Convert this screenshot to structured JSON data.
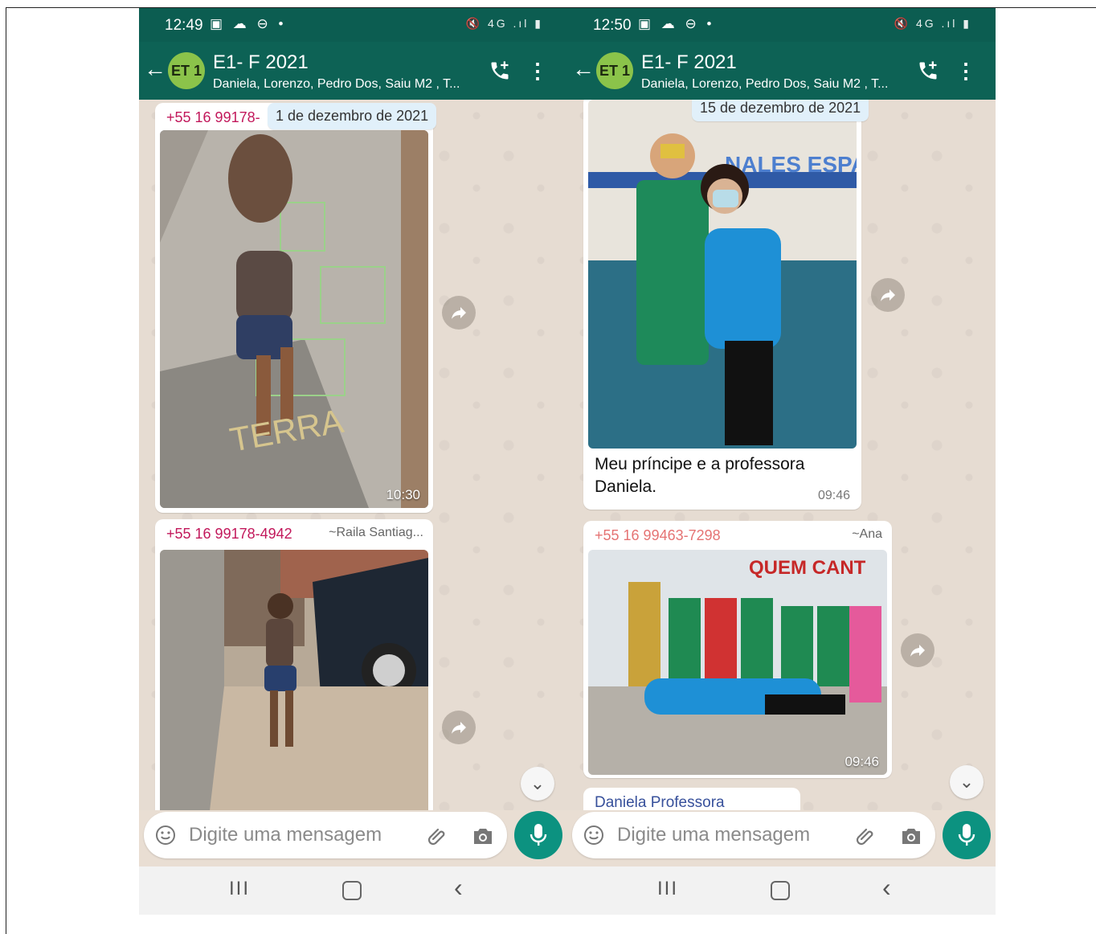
{
  "left": {
    "status_time": "12:49",
    "status_icons_left": "▣ ☁ ⊖ •",
    "status_icons_right": "🔇 4G .ıl ▮",
    "chat_title": "E1- F 2021",
    "chat_subtitle": "Daniela, Lorenzo, Pedro Dos, Saiu M2 , T...",
    "avatar_text": "ET 1",
    "date_chip": "1 de dezembro de 2021",
    "msg1": {
      "sender_phone": "+55 16 99178-",
      "time": "10:30",
      "photo_text": "TERRA"
    },
    "msg2": {
      "sender_phone": "+55 16 99178-4942",
      "sender_alias": "~Raila Santiag..."
    },
    "input_placeholder": "Digite uma mensagem",
    "nav": {
      "recents": "III",
      "back": "‹"
    }
  },
  "right": {
    "status_time": "12:50",
    "status_icons_left": "▣ ☁ ⊖ •",
    "status_icons_right": "🔇 4G .ıl ▮",
    "chat_title": "E1- F 2021",
    "chat_subtitle": "Daniela, Lorenzo, Pedro Dos, Saiu M2 , T...",
    "avatar_text": "ET 1",
    "date_chip": "15 de dezembro de 2021",
    "msg1": {
      "caption_line1": "Meu príncipe e a professora",
      "caption_line2": "Daniela.",
      "time": "09:46",
      "photo_text": "NALES ESPAN"
    },
    "msg2": {
      "sender_phone": "+55 16 99463-7298",
      "sender_alias": "~Ana",
      "time": "09:46",
      "photo_text": "QUEM CANT"
    },
    "quoted_sender": "Daniela Professora",
    "input_placeholder": "Digite uma mensagem",
    "nav": {
      "recents": "III",
      "back": "‹"
    }
  },
  "colors": {
    "header": "#0d6255",
    "statusbar": "#0c5d51",
    "accent": "#0c9280",
    "chat_bg": "#e6dcd2",
    "date_chip": "#e1f0fa"
  }
}
